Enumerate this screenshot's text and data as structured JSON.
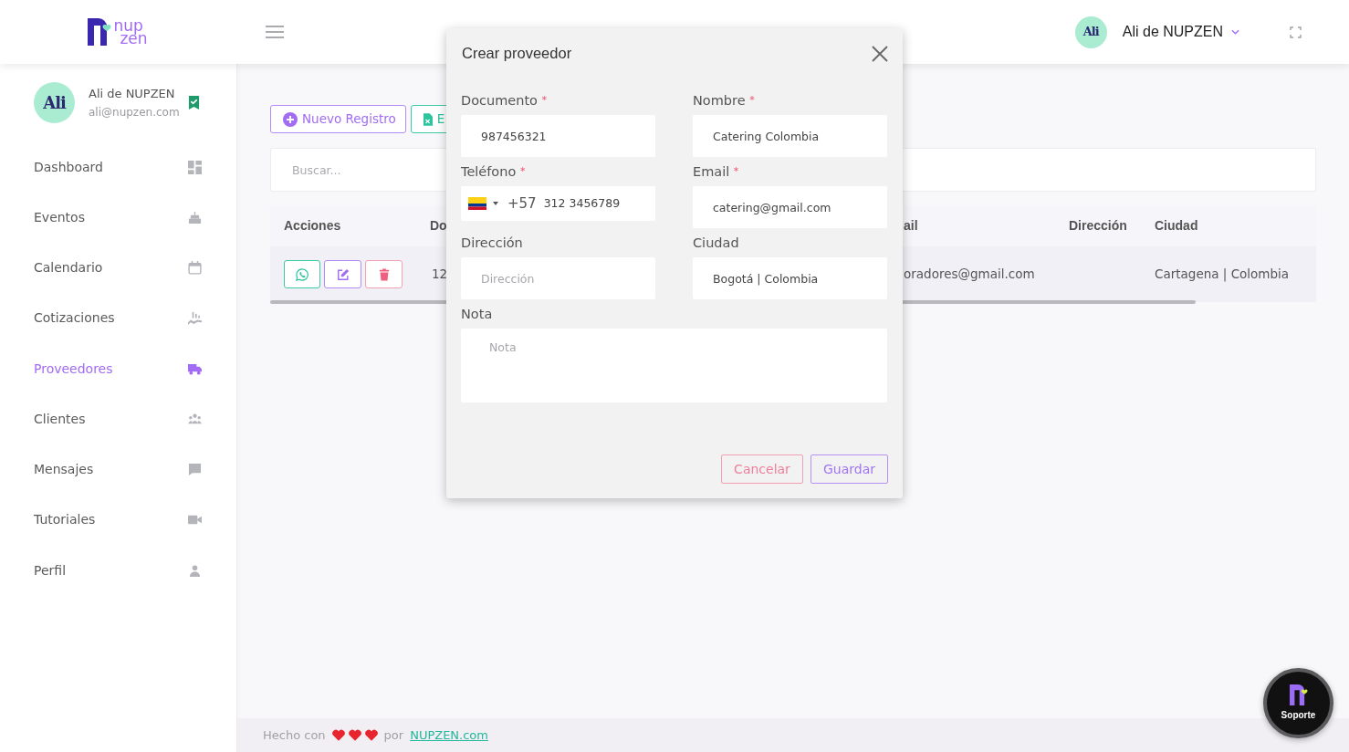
{
  "topbar": {
    "logo": {
      "line1": "nup",
      "line2": "zen"
    },
    "user": {
      "avatar_text": "Ali",
      "name": "Ali de NUPZEN"
    }
  },
  "sidebar": {
    "profile": {
      "avatar_text": "Ali",
      "name": "Ali de NUPZEN",
      "email": "ali@nupzen.com",
      "verified": true
    },
    "items": [
      {
        "label": "Dashboard",
        "selected": false
      },
      {
        "label": "Eventos",
        "selected": false
      },
      {
        "label": "Calendario",
        "selected": false
      },
      {
        "label": "Cotizaciones",
        "selected": false
      },
      {
        "label": "Proveedores",
        "selected": true
      },
      {
        "label": "Clientes",
        "selected": false
      },
      {
        "label": "Mensajes",
        "selected": false
      },
      {
        "label": "Tutoriales",
        "selected": false
      },
      {
        "label": "Perfil",
        "selected": false
      }
    ]
  },
  "toolbar": {
    "buttons": [
      {
        "label": "Nuevo Registro",
        "kind": "add"
      },
      {
        "label": "E",
        "kind": "spreadsheet"
      }
    ]
  },
  "search": {
    "placeholder": "Buscar..."
  },
  "table": {
    "columns": [
      "Acciones",
      "Do",
      "ail",
      "Dirección",
      "Ciudad"
    ],
    "rows": [
      {
        "actions": [
          {
            "kind": "chat"
          },
          {
            "kind": "edit"
          },
          {
            "kind": "delete"
          }
        ],
        "column_2": "12",
        "column_3": "oradores@gmail.com",
        "column_5": "Cartagena | Colombia"
      }
    ]
  },
  "modal": {
    "title": "Crear proveedor",
    "fields": [
      {
        "label": "Documento",
        "required_mark": "*",
        "kind": "text",
        "value": "987456321"
      },
      {
        "label": "Nombre",
        "required_mark": "*",
        "kind": "text",
        "value": "Catering Colombia"
      },
      {
        "label": "Teléfono",
        "required_mark": "*",
        "kind": "phone",
        "dial_code": "+57",
        "value": "312 3456789"
      },
      {
        "label": "Email",
        "required_mark": "*",
        "kind": "text",
        "value": "catering@gmail.com"
      },
      {
        "label": "Dirección",
        "kind": "text",
        "placeholder": "Dirección"
      },
      {
        "label": "Ciudad",
        "kind": "text",
        "value": "Bogotá | Colombia"
      },
      {
        "label": "Nota",
        "kind": "textarea",
        "placeholder": "Nota"
      }
    ],
    "buttons": [
      {
        "label": "Cancelar",
        "kind": "cancel"
      },
      {
        "label": "Guardar",
        "kind": "save"
      }
    ]
  },
  "footer": {
    "text": "Hecho con",
    "by": "por",
    "link": "NUPZEN.com"
  },
  "support": {
    "label": "Soporte"
  }
}
